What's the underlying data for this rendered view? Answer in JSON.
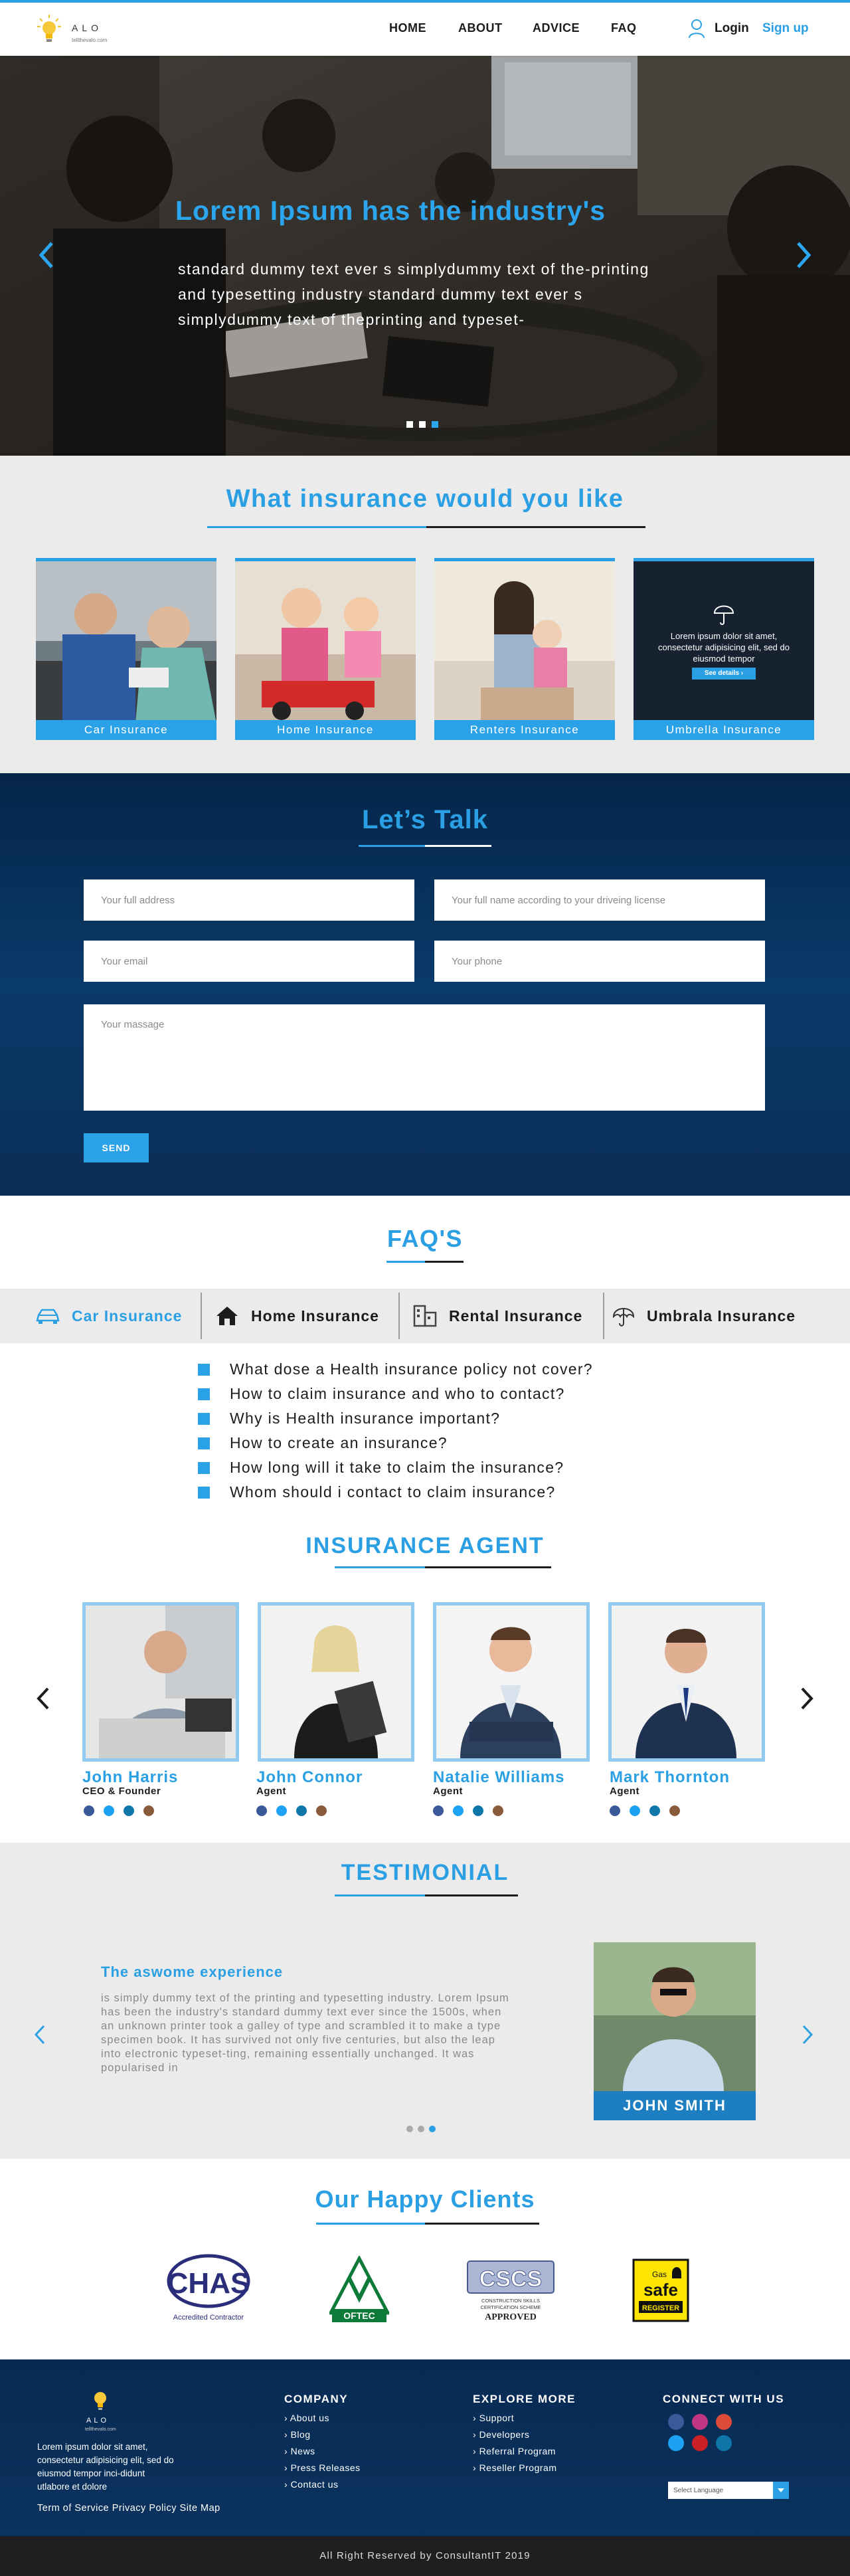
{
  "header": {
    "logo_title": "ALO",
    "logo_sub": "tellthevalo.com",
    "nav": [
      "HOME",
      "ABOUT",
      "ADVICE",
      "FAQ"
    ],
    "login": "Login",
    "signup": "Sign up"
  },
  "hero": {
    "title": "Lorem Ipsum has the industry's",
    "text": "standard dummy text ever s simplydummy text of the-printing and typesetting industry standard dummy text ever s simplydummy text of theprinting and typeset-",
    "active_slide": 3,
    "slides": 3
  },
  "insurance": {
    "title": "What insurance would you like",
    "cards": [
      "Car Insurance",
      "Home Insurance",
      "Renters Insurance",
      "Umbrella Insurance"
    ],
    "overlay_text": "Lorem ipsum dolor sit amet, consectetur adipisicing elit, sed do eiusmod tempor",
    "overlay_button": "See details"
  },
  "talk": {
    "title": "Let’s Talk",
    "address_ph": "Your full address",
    "name_ph": "Your full name according to your driveing license",
    "email_ph": "Your email",
    "phone_ph": "Your phone",
    "message_ph": "Your massage",
    "send": "SEND"
  },
  "faq": {
    "title": "FAQ'S",
    "tabs": [
      "Car Insurance",
      "Home Insurance",
      "Rental Insurance",
      "Umbrala Insurance"
    ],
    "questions": [
      "What dose a Health insurance policy not cover?",
      "How to claim insurance and who to contact?",
      "Why is Health insurance important?",
      "How to create an insurance?",
      "How long will it take to claim the insurance?",
      "Whom should i contact to claim insurance?"
    ]
  },
  "agents": {
    "title": "INSURANCE AGENT",
    "list": [
      {
        "name": "John Harris",
        "role": "CEO & Founder"
      },
      {
        "name": "John Connor",
        "role": "Agent"
      },
      {
        "name": "Natalie Williams",
        "role": "Agent"
      },
      {
        "name": "Mark Thornton",
        "role": "Agent"
      }
    ]
  },
  "testimonial": {
    "title": "TESTIMONIAL",
    "heading": "The aswome experience",
    "text": "is simply dummy text of the printing and typesetting industry. Lorem Ipsum has been the industry's standard dummy text ever since the 1500s, when an unknown printer took a galley of type and scrambled it to make a type specimen book. It has survived not only five centuries, but also the leap into electronic typeset-ting, remaining essentially unchanged. It was popularised in",
    "person": "JOHN SMITH",
    "active_dot": 3
  },
  "clients": {
    "title": "Our Happy Clients",
    "logos": [
      {
        "name": "CHAS",
        "sub": "Accredited Contractor"
      },
      {
        "name": "OFTEC",
        "sub": ""
      },
      {
        "name": "CSCS",
        "sub": "CONSTRUCTION SKILLS CERTIFICATION SCHEME",
        "sub2": "APPROVED"
      },
      {
        "name": "safe",
        "sub": "Gas",
        "sub2": "REGISTER"
      }
    ]
  },
  "footer": {
    "logo_title": "ALO",
    "logo_sub": "tellthevalo.com",
    "about": "Lorem ipsum dolor sit amet, consectetur adipisicing elit, sed do eiusmod tempor inci-didunt utlabore et dolore",
    "legal": "Term of Service Privacy Policy Site Map",
    "company_h": "COMPANY",
    "company": [
      "About us",
      "Blog",
      "News",
      "Press Releases",
      "Contact us"
    ],
    "explore_h": "EXPLORE MORE",
    "explore": [
      "Support",
      "Developers",
      "Referral Program",
      "Reseller Program"
    ],
    "connect_h": "CONNECT WITH US",
    "language": "Select Language",
    "copyright": "All Right Reserved by ConsultantIT 2019"
  },
  "colors": {
    "accent": "#2b9fe3",
    "navy": "#072a52",
    "light_bg": "#ecebeb"
  }
}
